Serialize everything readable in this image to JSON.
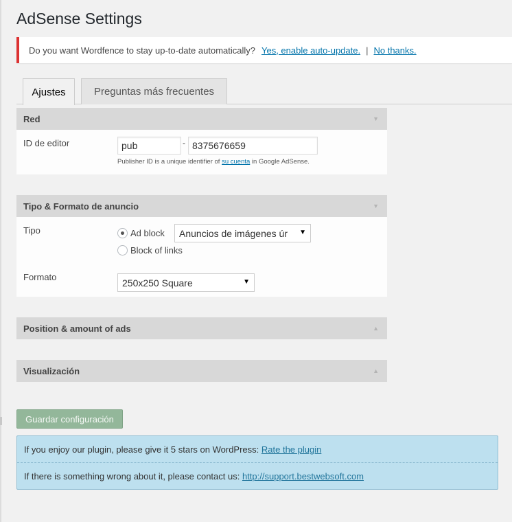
{
  "page": {
    "title": "AdSense Settings"
  },
  "notice": {
    "question": "Do you want Wordfence to stay up-to-date automatically?",
    "enable_link": "Yes, enable auto-update.",
    "separator": "|",
    "decline_link": "No thanks."
  },
  "tabs": [
    {
      "label": "Ajustes",
      "active": true
    },
    {
      "label": "Preguntas más frecuentes",
      "active": false
    }
  ],
  "red_section": {
    "title": "Red",
    "publisher_label": "ID de editor",
    "prefix_value": "pub",
    "dash": "-",
    "id_value": "8375676659",
    "hint_before": "Publisher ID is a unique identifier of ",
    "hint_link": "su cuenta",
    "hint_after": " in Google AdSense."
  },
  "tipo_section": {
    "title": "Tipo & Formato de anuncio",
    "tipo_label": "Tipo",
    "radio_ad_block": "Ad block",
    "radio_block_links": "Block of links",
    "selected_radio": "Ad block",
    "ad_type_value": "Anuncios de imágenes úr",
    "formato_label": "Formato",
    "formato_value": "250x250 Square"
  },
  "position_section": {
    "title": "Position & amount of ads"
  },
  "visual_section": {
    "title": "Visualización"
  },
  "save_button": {
    "label": "Guardar configuración"
  },
  "info": {
    "rate_text": "If you enjoy our plugin, please give it 5 stars on WordPress: ",
    "rate_link": "Rate the plugin",
    "support_text": "If there is something wrong about it, please contact us: ",
    "support_link": "http://support.bestwebsoft.com"
  },
  "colors": {
    "notice_border": "#dc3232",
    "link": "#0073aa",
    "save_button": "#93b79a",
    "info_background": "#bde0ef"
  }
}
